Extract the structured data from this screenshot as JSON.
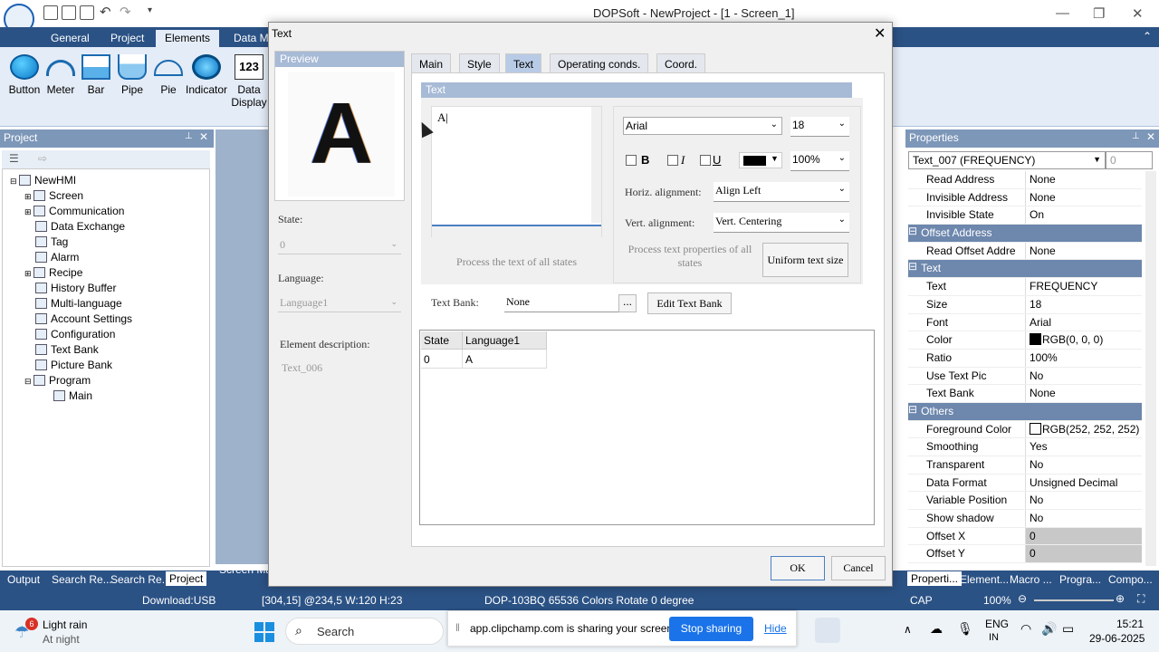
{
  "titlebar": {
    "title": "DOPSoft - NewProject - [1 - Screen_1]",
    "minimize": "—",
    "restore": "❐",
    "close": "✕"
  },
  "ribbon": {
    "tabs": [
      "General",
      "Project",
      "Elements",
      "Data M"
    ],
    "active_tab": "Elements",
    "tools": [
      {
        "label": "Button",
        "icon": "button-icon"
      },
      {
        "label": "Meter",
        "icon": "meter-icon"
      },
      {
        "label": "Bar",
        "icon": "bar-icon"
      },
      {
        "label": "Pipe",
        "icon": "pipe-icon"
      },
      {
        "label": "Pie",
        "icon": "pie-icon"
      },
      {
        "label": "Indicator",
        "icon": "indicator-icon"
      },
      {
        "label": "Data",
        "sub": "Display",
        "icon_text": "123"
      }
    ]
  },
  "project": {
    "header": "Project",
    "pin": "ᵖ",
    "close": "✕",
    "root": "NewHMI",
    "items": [
      "Screen",
      "Communication",
      "Data Exchange",
      "Tag",
      "Alarm",
      "Recipe",
      "History Buffer",
      "Multi-language",
      "Account Settings",
      "Configuration",
      "Text Bank",
      "Picture Bank",
      "Program",
      "Main"
    ]
  },
  "bottom_tabs": [
    "Output",
    "Search Re...",
    "Search Re...",
    "Project",
    "Screen Ma"
  ],
  "right_tabs": [
    "Properti...",
    "Element...",
    "Macro ...",
    "Progra...",
    "Compo..."
  ],
  "status": {
    "download": "Download:USB",
    "coords": "[304,15] @234,5 W:120 H:23",
    "device": "DOP-103BQ 65536 Colors Rotate 0 degree",
    "caps": "CAP",
    "zoom": "100%"
  },
  "properties": {
    "header": "Properties",
    "selected": "Text_007 (FREQUENCY)",
    "number": "0",
    "rows": [
      {
        "k": "Read Address",
        "v": "None"
      },
      {
        "k": "Invisible Address",
        "v": "None"
      },
      {
        "k": "Invisible State",
        "v": "On"
      },
      {
        "cat": "Offset Address"
      },
      {
        "k": "Read Offset Addre",
        "v": "None"
      },
      {
        "cat": "Text"
      },
      {
        "k": "Text",
        "v": "FREQUENCY"
      },
      {
        "k": "Size",
        "v": "18"
      },
      {
        "k": "Font",
        "v": "Arial"
      },
      {
        "k": "Color",
        "v": "RGB(0, 0, 0)",
        "swatch": "#000000"
      },
      {
        "k": "Ratio",
        "v": "100%"
      },
      {
        "k": "Use Text Pic",
        "v": "No"
      },
      {
        "k": "Text Bank",
        "v": "None"
      },
      {
        "cat": "Others"
      },
      {
        "k": "Foreground Color",
        "v": "RGB(252, 252, 252)",
        "swatch": "#fcfcfc"
      },
      {
        "k": "Smoothing",
        "v": "Yes"
      },
      {
        "k": "Transparent",
        "v": "No"
      },
      {
        "k": "Data Format",
        "v": "Unsigned Decimal"
      },
      {
        "k": "Variable Position",
        "v": "No"
      },
      {
        "k": "Show shadow",
        "v": "No"
      },
      {
        "k": "Offset X",
        "v": "0",
        "grey": true
      },
      {
        "k": "Offset Y",
        "v": "0",
        "grey": true
      }
    ]
  },
  "dialog": {
    "title": "Text",
    "close": "✕",
    "preview_label": "Preview",
    "preview_char": "A",
    "state_label": "State:",
    "state_value": "0",
    "language_label": "Language:",
    "language_value": "Language1",
    "desc_label": "Element description:",
    "desc_value": "Text_006",
    "tabs": [
      "Main",
      "Style",
      "Text",
      "Operating conds.",
      "Coord."
    ],
    "active_tab": "Text",
    "text_group": "Text",
    "text_content": "A|",
    "process_all_states": "Process the text of all states",
    "font": "Arial",
    "size": "18",
    "bold": "B",
    "italic": "I",
    "underline": "U",
    "color": "#000000",
    "ratio": "100%",
    "halign_label": "Horiz. alignment:",
    "halign": "Align Left",
    "valign_label": "Vert. alignment:",
    "valign": "Vert. Centering",
    "process_props": "Process text properties of all states",
    "uniform": "Uniform text size",
    "textbank_label": "Text Bank:",
    "textbank_value": "None",
    "ellipsis": "...",
    "edit_textbank": "Edit Text Bank",
    "table": {
      "headers": [
        "State",
        "Language1"
      ],
      "rows": [
        [
          "0",
          "A"
        ]
      ]
    },
    "ok": "OK",
    "cancel": "Cancel"
  },
  "taskbar": {
    "weather_badge": "6",
    "weather": "Light rain",
    "weather_sub": "At night",
    "search": "Search",
    "share_text": "app.clipchamp.com is sharing your screen.",
    "stop": "Stop sharing",
    "hide": "Hide",
    "lang": "ENG",
    "lang_sub": "IN",
    "time": "15:21",
    "date": "29-06-2025"
  }
}
